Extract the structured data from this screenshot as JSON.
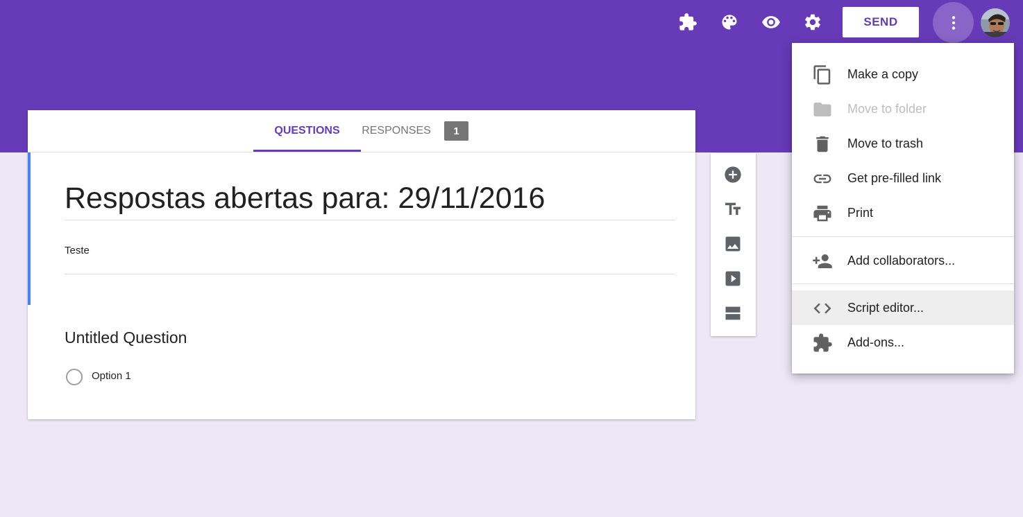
{
  "header": {
    "send_label": "SEND",
    "icons": [
      "puzzle-icon",
      "palette-icon",
      "eye-icon",
      "gear-icon",
      "more-vert-icon"
    ]
  },
  "tabs": [
    {
      "label": "QUESTIONS",
      "active": true
    },
    {
      "label": "RESPONSES",
      "active": false,
      "badge": "1"
    }
  ],
  "form": {
    "title": "Respostas abertas para: 29/11/2016",
    "description": "Teste"
  },
  "question": {
    "title": "Untitled Question",
    "options": [
      "Option 1"
    ]
  },
  "side_toolbar": [
    "add-question-icon",
    "title-text-icon",
    "image-icon",
    "video-icon",
    "section-icon"
  ],
  "menu": {
    "items": [
      {
        "label": "Make a copy",
        "icon": "copy-icon"
      },
      {
        "label": "Move to folder",
        "icon": "folder-icon",
        "disabled": true
      },
      {
        "label": "Move to trash",
        "icon": "trash-icon"
      },
      {
        "label": "Get pre-filled link",
        "icon": "link-icon"
      },
      {
        "label": "Print",
        "icon": "print-icon"
      },
      {
        "label": "Add collaborators...",
        "icon": "add-people-icon"
      },
      {
        "label": "Script editor...",
        "icon": "code-icon",
        "highlighted": true
      },
      {
        "label": "Add-ons...",
        "icon": "puzzle-icon"
      }
    ]
  },
  "colors": {
    "accent": "#673ab7",
    "background": "#ede7f6",
    "title_border": "#4285f4"
  }
}
